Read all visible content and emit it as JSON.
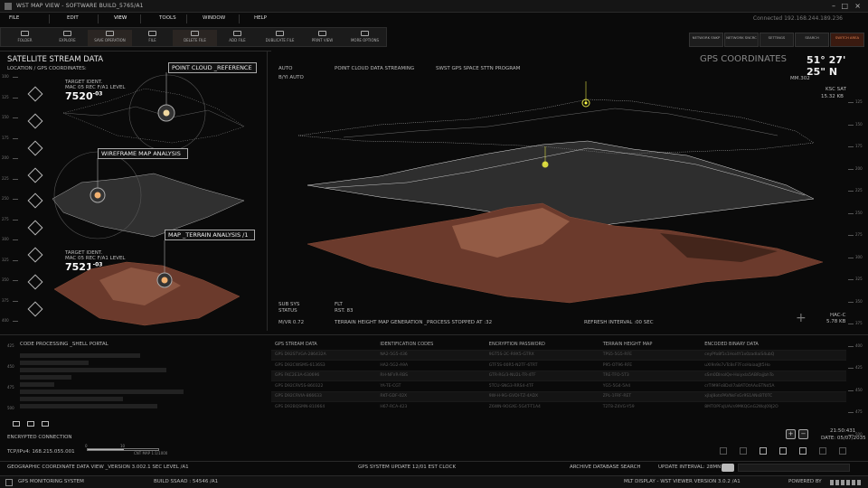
{
  "window": {
    "title": "WST MAP VIEW - SOFTWARE BUILD_5765/A1"
  },
  "menu": [
    "FILE",
    "EDIT",
    "VIEW",
    "TOOLS",
    "WINDOW",
    "HELP"
  ],
  "top_status": "Connected 192.168.244.189.236",
  "toolbar": [
    {
      "label": "FOLDER",
      "icon": "folder-icon"
    },
    {
      "label": "EXPLORE",
      "icon": "explore-icon"
    },
    {
      "label": "SAVE OPERATION",
      "icon": "save-icon"
    },
    {
      "label": "FILE",
      "icon": "file-icon"
    },
    {
      "label": "DELETE FILE",
      "icon": "delete-icon"
    },
    {
      "label": "ADD FILE",
      "icon": "add-file-icon"
    },
    {
      "label": "DUBLICATE FILE",
      "icon": "duplicate-icon"
    },
    {
      "label": "PRINT VIEW",
      "icon": "print-icon"
    },
    {
      "label": "MORE OPTIONS",
      "icon": "more-options-icon"
    }
  ],
  "right_buttons": [
    {
      "label": "NETWORK SNKP"
    },
    {
      "label": "NETWORK SNCRC"
    },
    {
      "label": "SETTINGS"
    },
    {
      "label": "SEARCH"
    },
    {
      "label": "SWITCH AREA"
    }
  ],
  "left_panel": {
    "title": "SATELLITE STREAM DATA",
    "subtitle": "LOCATION / GPS COORDINATES:",
    "target1": {
      "line1": "TARGET IDENT.",
      "line2": "MAC 05 REC F/A1 LEVEL",
      "code": "7520",
      "sup": "-03"
    },
    "target2": {
      "line1": "TARGET IDENT.",
      "line2": "MAC 05 REC F/A1 LEVEL",
      "code": "7521",
      "sup": "-03"
    },
    "label_pointcloud": "POINT CLOUD _REFERENCE",
    "label_wireframe": "WIREFRAME MAP ANALYSIS",
    "label_terrain": "MAP _TERRAIN ANALYSIS /1",
    "ruler_ticks": [
      "100",
      "125",
      "150",
      "175",
      "200",
      "225",
      "250",
      "275",
      "300",
      "325",
      "350",
      "375",
      "400"
    ],
    "ruler_ticks_bottom": [
      "425",
      "450",
      "475",
      "500"
    ]
  },
  "main": {
    "auto": "AUTO",
    "auto_ratio": "B/YI AUTO",
    "point_cloud_streaming": "POINT CLOUD DATA STREAMING",
    "program": "SWST GPS SPACE STTN PROGRAM",
    "gps_title": "GPS COORDINATES",
    "gps_value": "51° 27' 25\" N",
    "mm": "MM.302",
    "ksc_label": "KSC SAT",
    "ksc_value": "15.32 KB",
    "sub_sys": "SUB SYS",
    "status": "STATUS",
    "flt": "FLT",
    "rst": "RST. 83",
    "mvr": "M/VR 0.72",
    "terrain_gen": "TERRAIN HEIGHT MAP GENERATION _PROCESS STOPPED AT :32",
    "refresh": "REFRESH INTERVAL :00 SEC",
    "hac_label": "HAC-C",
    "hac_value": "5.78 KB",
    "right_ticks": [
      "125",
      "150",
      "175",
      "200",
      "225",
      "250",
      "275",
      "300",
      "325",
      "350",
      "375",
      "400",
      "425",
      "450",
      "475",
      "500"
    ]
  },
  "console": {
    "title": "CODE PROCESSING _SHELL PORTAL",
    "connection": "ENCRYPTED CONNECTION",
    "tcp": "TCP/IPv4: 168.215.055.001",
    "scale_min": "0",
    "scale_mid": "10",
    "scale_label": "CNT MAP 1:1/1000"
  },
  "table": {
    "headers": [
      "GPS STREAM DATA",
      "IDENTIFICATION CODES",
      "ENCRYPTION PASSWORD",
      "TERRAIN HEIGHT MAP",
      "ENCODED BINARY DATA"
    ],
    "rows": [
      [
        "GPS D92STVGA-286432A",
        "NA2-5G5-436",
        "9GT5S-2C-R9X5-GTRX",
        "TPS5-5G5-RFE",
        "ceyPfo8f1s1Hoi4Y1x0zadlaiS4ubQ"
      ],
      [
        "GPS D92CWSMS-6136S3",
        "HA2-5G2-A9A",
        "GTF5S-00R5-N2TF-6TRT",
        "P95-OT96-RFE",
        "uXl9n9s7vTc8sF7FcsHaiaaJJt5Ho"
      ],
      [
        "GPS FKC2E3A-630696",
        "RH-NFVR-RBS",
        "GTR-RG/3-NU2L-TR-4TF",
        "TRE-TFO-5T3",
        "sSm0DlnolQe-Hoiyxla5ABRajjbhTo"
      ],
      [
        "GPS D92CRV5S-860322",
        "YA-TE-CGT",
        "5TCU-SNG3-RRS4-4TF",
        "YG5-5G4-5A4",
        "crTlM9Fs8Dsll7a8ATOtAAoSTNd5A"
      ],
      [
        "GPS D92CRVIA-866633",
        "RKT-GDF-02X",
        "9W-H-9G-GVDI-TZ-4ADX",
        "ZPL-1FRF-RET",
        "xjlaJ8otsPAVNsFsGr9S1ANsBT0TC"
      ],
      [
        "GPS D92BQSMN-810664",
        "H67-RCA-423",
        "Z6WN-9OGXE-5G4T-T1A4",
        "T2T8-Z4VG-Y59",
        "8MTOPFoJUAi/s9MKQGnG2WoJ09J2O"
      ]
    ]
  },
  "clock": {
    "time": "21:50:431",
    "date": "DATE: 05/07/2035"
  },
  "footer1": {
    "left": "GEOGRAPHIC COORDINATE DATA VIEW _VERSION 3.002.1 SEC LEVEL /A1",
    "center": "GPS SYSTEM UPDATE 12/01 EST CLOCK",
    "archive": "ARCHIVE DATABASE SEARCH",
    "update": "UPDATE INTERVAL: 28MN"
  },
  "footer2": {
    "left": "GPS MONITORING SYSTEM",
    "build": "BUILD SSAAD : 54546  /A1",
    "display": "MLT DISPLAY - WST VIEWER  VERSION 3.0.2 /A1",
    "powered": "POWERED BY"
  },
  "colors": {
    "accent": "#e0a050",
    "bg": "#0a0a0a",
    "panel": "#1b1b1b"
  }
}
